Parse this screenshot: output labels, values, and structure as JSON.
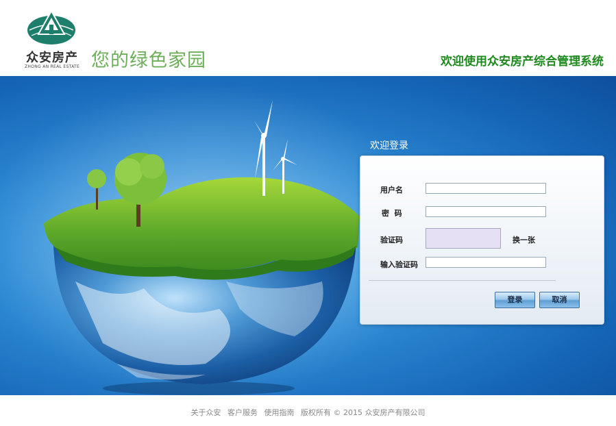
{
  "header": {
    "logo_cn": "众安房产",
    "logo_en": "ZHONG AN REAL ESTATE",
    "slogan": "您的绿色家园",
    "system_title": "欢迎使用众安房产综合管理系统"
  },
  "login": {
    "title": "欢迎登录",
    "username_label": "用户名",
    "password_label": "密  码",
    "captcha_label": "验证码",
    "captcha_change": "换一张",
    "captcha_input_label": "输入验证码",
    "username_value": "",
    "password_value": "",
    "captcha_value": "",
    "login_button": "登录",
    "cancel_button": "取消"
  },
  "footer": {
    "links": [
      "关于众安",
      "客户服务",
      "使用指南"
    ],
    "copyright": "版权所有 © 2015 众安房产有限公司"
  },
  "colors": {
    "brand_green": "#1e8a1e",
    "slogan_green": "#6cae5a",
    "banner_blue": "#1565b6",
    "logo_teal": "#1d7e6b"
  }
}
